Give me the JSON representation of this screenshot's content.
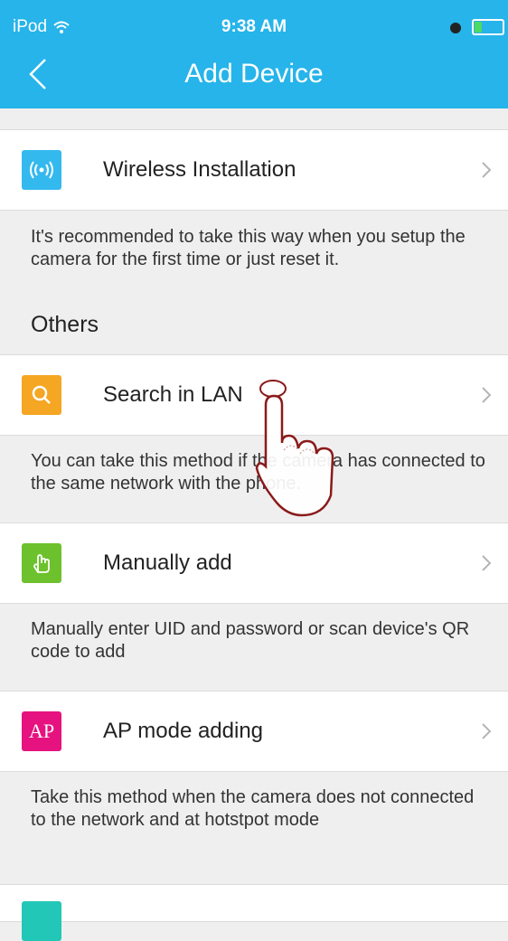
{
  "status_bar": {
    "carrier": "iPod",
    "time": "9:38 AM"
  },
  "header": {
    "title": "Add Device"
  },
  "rows": [
    {
      "label": "Wireless Installation",
      "icon": "wifi-signal-icon",
      "color": "#34b9ee",
      "desc": "It's recommended to take this way when you setup the camera for the first time or just reset it."
    },
    {
      "label": "Search in LAN",
      "icon": "search-icon",
      "color": "#f5a623",
      "desc": "You can take this method if the camera has connected to the same network with the phone."
    },
    {
      "label": "Manually add",
      "icon": "hand-pointer-icon",
      "color": "#6cc12c",
      "desc": "Manually enter UID and password or scan device's QR code to add"
    },
    {
      "label": "AP mode adding",
      "icon": "ap-icon",
      "icon_text": "AP",
      "color": "#e6127f",
      "desc": "Take this method when the camera does not connected to the network and at hotstpot mode"
    }
  ],
  "section": {
    "others_label": "Others"
  },
  "accent": "#26b4ea"
}
